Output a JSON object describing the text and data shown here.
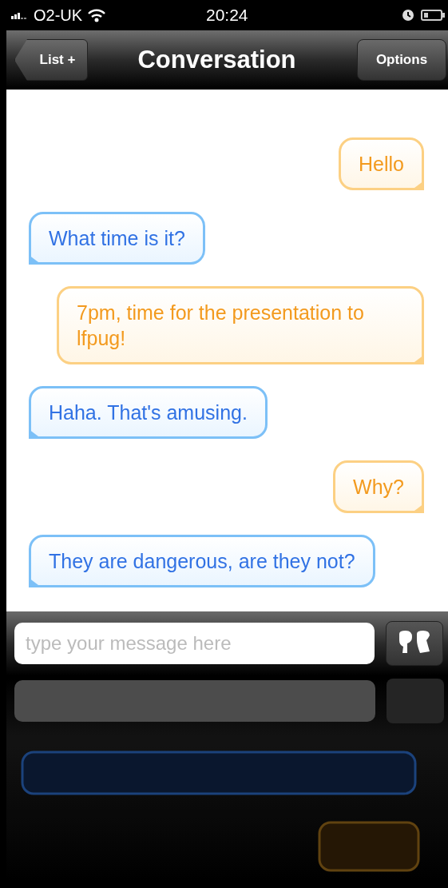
{
  "status_bar": {
    "carrier": "O2-UK",
    "time": "20:24"
  },
  "nav_bar": {
    "back_button": "List +",
    "title": "Conversation",
    "right_button": "Options"
  },
  "messages": [
    {
      "kind": "sent",
      "text": "Hello"
    },
    {
      "kind": "received",
      "text": "What time is it?"
    },
    {
      "kind": "sent",
      "text": "7pm, time for the presentation to lfpug!"
    },
    {
      "kind": "received",
      "text": "Haha. That's amusing."
    },
    {
      "kind": "sent",
      "text": "Why?"
    },
    {
      "kind": "received",
      "text": "They are dangerous, are they not?"
    }
  ],
  "composer": {
    "placeholder": "type your message here"
  }
}
